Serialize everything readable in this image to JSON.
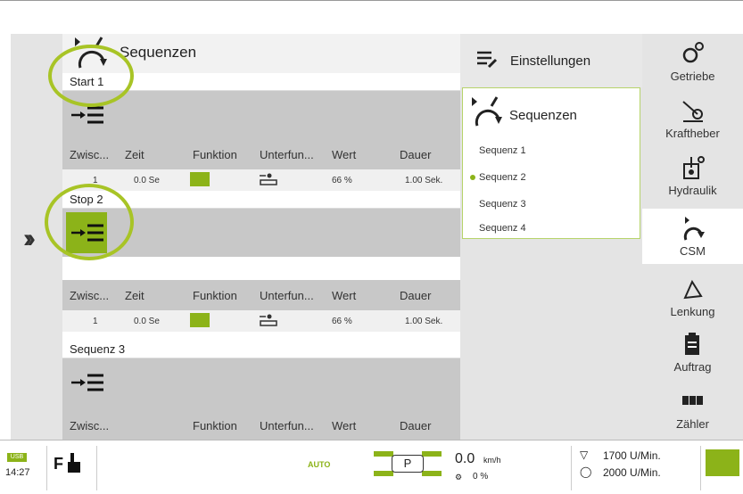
{
  "main": {
    "title": "Sequenzen",
    "blocks": [
      {
        "name": "Start 1",
        "columns": [
          "Zwisc...",
          "Zeit",
          "Funktion",
          "Unterfun...",
          "Wert",
          "Dauer"
        ],
        "row": {
          "index": "1",
          "time": "0.0 Se",
          "value": "66 %",
          "duration": "1.00 Sek."
        }
      },
      {
        "name": "Stop 2",
        "columns": [
          "Zwisc...",
          "Zeit",
          "Funktion",
          "Unterfun...",
          "Wert",
          "Dauer"
        ],
        "row": {
          "index": "1",
          "time": "0.0 Se",
          "value": "66 %",
          "duration": "1.00 Sek."
        }
      },
      {
        "name": "Sequenz 3",
        "columns": [
          "Zwisc...",
          "",
          "Funktion",
          "Unterfun...",
          "Wert",
          "Dauer"
        ]
      }
    ]
  },
  "settings": {
    "title": "Einstellungen",
    "panel_title": "Sequenzen",
    "items": [
      "Sequenz 1",
      "Sequenz 2",
      "Sequenz 3",
      "Sequenz 4"
    ],
    "selected_index": 1
  },
  "nav": {
    "items": [
      {
        "label": "Getriebe",
        "icon": "gears-icon"
      },
      {
        "label": "Kraftheber",
        "icon": "hitch-icon"
      },
      {
        "label": "Hydraulik",
        "icon": "hydraulic-icon"
      },
      {
        "label": "CSM",
        "icon": "sequence-icon"
      },
      {
        "label": "Lenkung",
        "icon": "steering-icon"
      },
      {
        "label": "Auftrag",
        "icon": "clipboard-icon"
      },
      {
        "label": "Zähler",
        "icon": "counter-icon"
      }
    ],
    "active": "CSM"
  },
  "status": {
    "time": "14:27",
    "usb": "USB",
    "mode": "AUTO",
    "gear": "P",
    "speed": "0.0",
    "speed_unit": "km/h",
    "slip": "0 %",
    "rpm1": "1700 U/Min.",
    "rpm2": "2000 U/Min."
  },
  "colors": {
    "accent": "#8cb319",
    "highlight_circle": "#a8c426"
  }
}
